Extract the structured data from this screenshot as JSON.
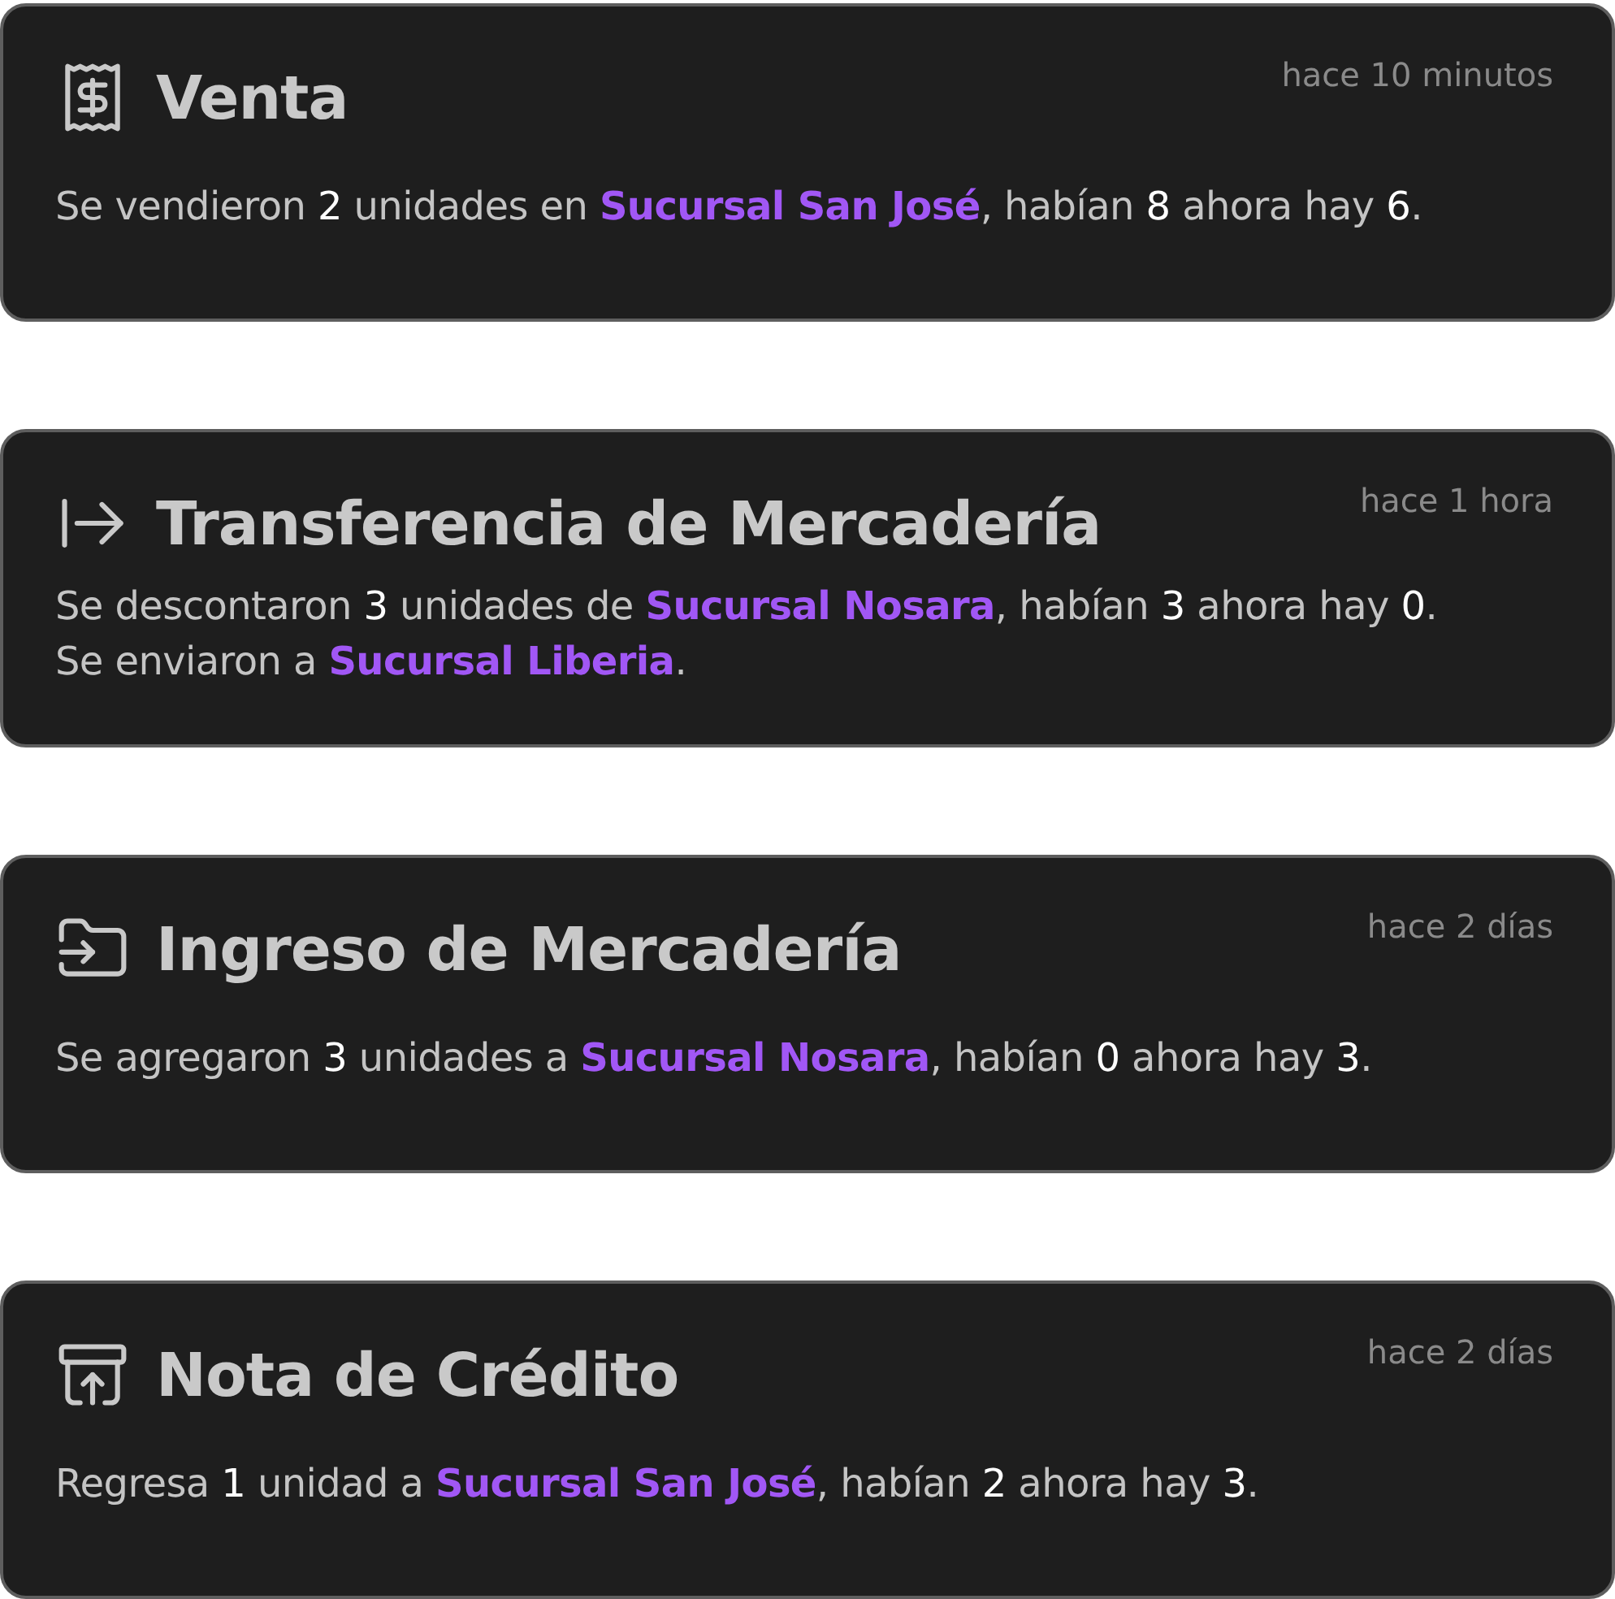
{
  "events": [
    {
      "kind": "sale",
      "title": "Venta",
      "time": "hace 10 minutos",
      "lines": [
        [
          {
            "kind": "text",
            "text": "Se vendieron "
          },
          {
            "kind": "number",
            "text": "2"
          },
          {
            "kind": "text",
            "text": " unidades en "
          },
          {
            "kind": "branch",
            "text": "Sucursal San José"
          },
          {
            "kind": "text",
            "text": ", habían "
          },
          {
            "kind": "number",
            "text": "8"
          },
          {
            "kind": "text",
            "text": " ahora hay "
          },
          {
            "kind": "number",
            "text": "6"
          },
          {
            "kind": "text",
            "text": "."
          }
        ]
      ]
    },
    {
      "kind": "transfer",
      "title": "Transferencia de Mercadería",
      "time": "hace 1 hora",
      "lines": [
        [
          {
            "kind": "text",
            "text": "Se descontaron "
          },
          {
            "kind": "number",
            "text": "3"
          },
          {
            "kind": "text",
            "text": " unidades de "
          },
          {
            "kind": "branch",
            "text": "Sucursal Nosara"
          },
          {
            "kind": "text",
            "text": ", habían "
          },
          {
            "kind": "number",
            "text": "3"
          },
          {
            "kind": "text",
            "text": " ahora hay "
          },
          {
            "kind": "number",
            "text": "0"
          },
          {
            "kind": "text",
            "text": "."
          }
        ],
        [
          {
            "kind": "text",
            "text": "Se enviaron a "
          },
          {
            "kind": "branch",
            "text": "Sucursal Liberia"
          },
          {
            "kind": "text",
            "text": "."
          }
        ]
      ]
    },
    {
      "kind": "intake",
      "title": "Ingreso de Mercadería",
      "time": "hace 2 días",
      "lines": [
        [
          {
            "kind": "text",
            "text": "Se agregaron "
          },
          {
            "kind": "number",
            "text": "3"
          },
          {
            "kind": "text",
            "text": " unidades a "
          },
          {
            "kind": "branch",
            "text": "Sucursal Nosara"
          },
          {
            "kind": "text",
            "text": ", habían "
          },
          {
            "kind": "number",
            "text": "0"
          },
          {
            "kind": "text",
            "text": " ahora hay "
          },
          {
            "kind": "number",
            "text": "3"
          },
          {
            "kind": "text",
            "text": "."
          }
        ]
      ]
    },
    {
      "kind": "credit",
      "title": "Nota de Crédito",
      "time": "hace 2 días",
      "lines": [
        [
          {
            "kind": "text",
            "text": "Regresa "
          },
          {
            "kind": "number",
            "text": "1"
          },
          {
            "kind": "text",
            "text": " unidad a "
          },
          {
            "kind": "branch",
            "text": "Sucursal San José"
          },
          {
            "kind": "text",
            "text": ", habían "
          },
          {
            "kind": "number",
            "text": "2"
          },
          {
            "kind": "text",
            "text": " ahora hay "
          },
          {
            "kind": "number",
            "text": "3"
          },
          {
            "kind": "text",
            "text": "."
          }
        ]
      ]
    }
  ]
}
